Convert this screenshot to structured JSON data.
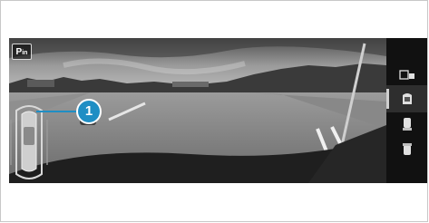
{
  "camera": {
    "mode_badge": "P",
    "mode_badge_sub": "in"
  },
  "callout": {
    "number": "1"
  },
  "side_panel": {
    "items": [
      {
        "icon": "parking-camera-icon",
        "active": false
      },
      {
        "icon": "car-top-view-icon",
        "active": true
      },
      {
        "icon": "rear-camera-icon",
        "active": false
      },
      {
        "icon": "front-camera-icon",
        "active": false
      }
    ]
  },
  "colors": {
    "callout": "#1f8ec4",
    "panel": "#111111"
  }
}
